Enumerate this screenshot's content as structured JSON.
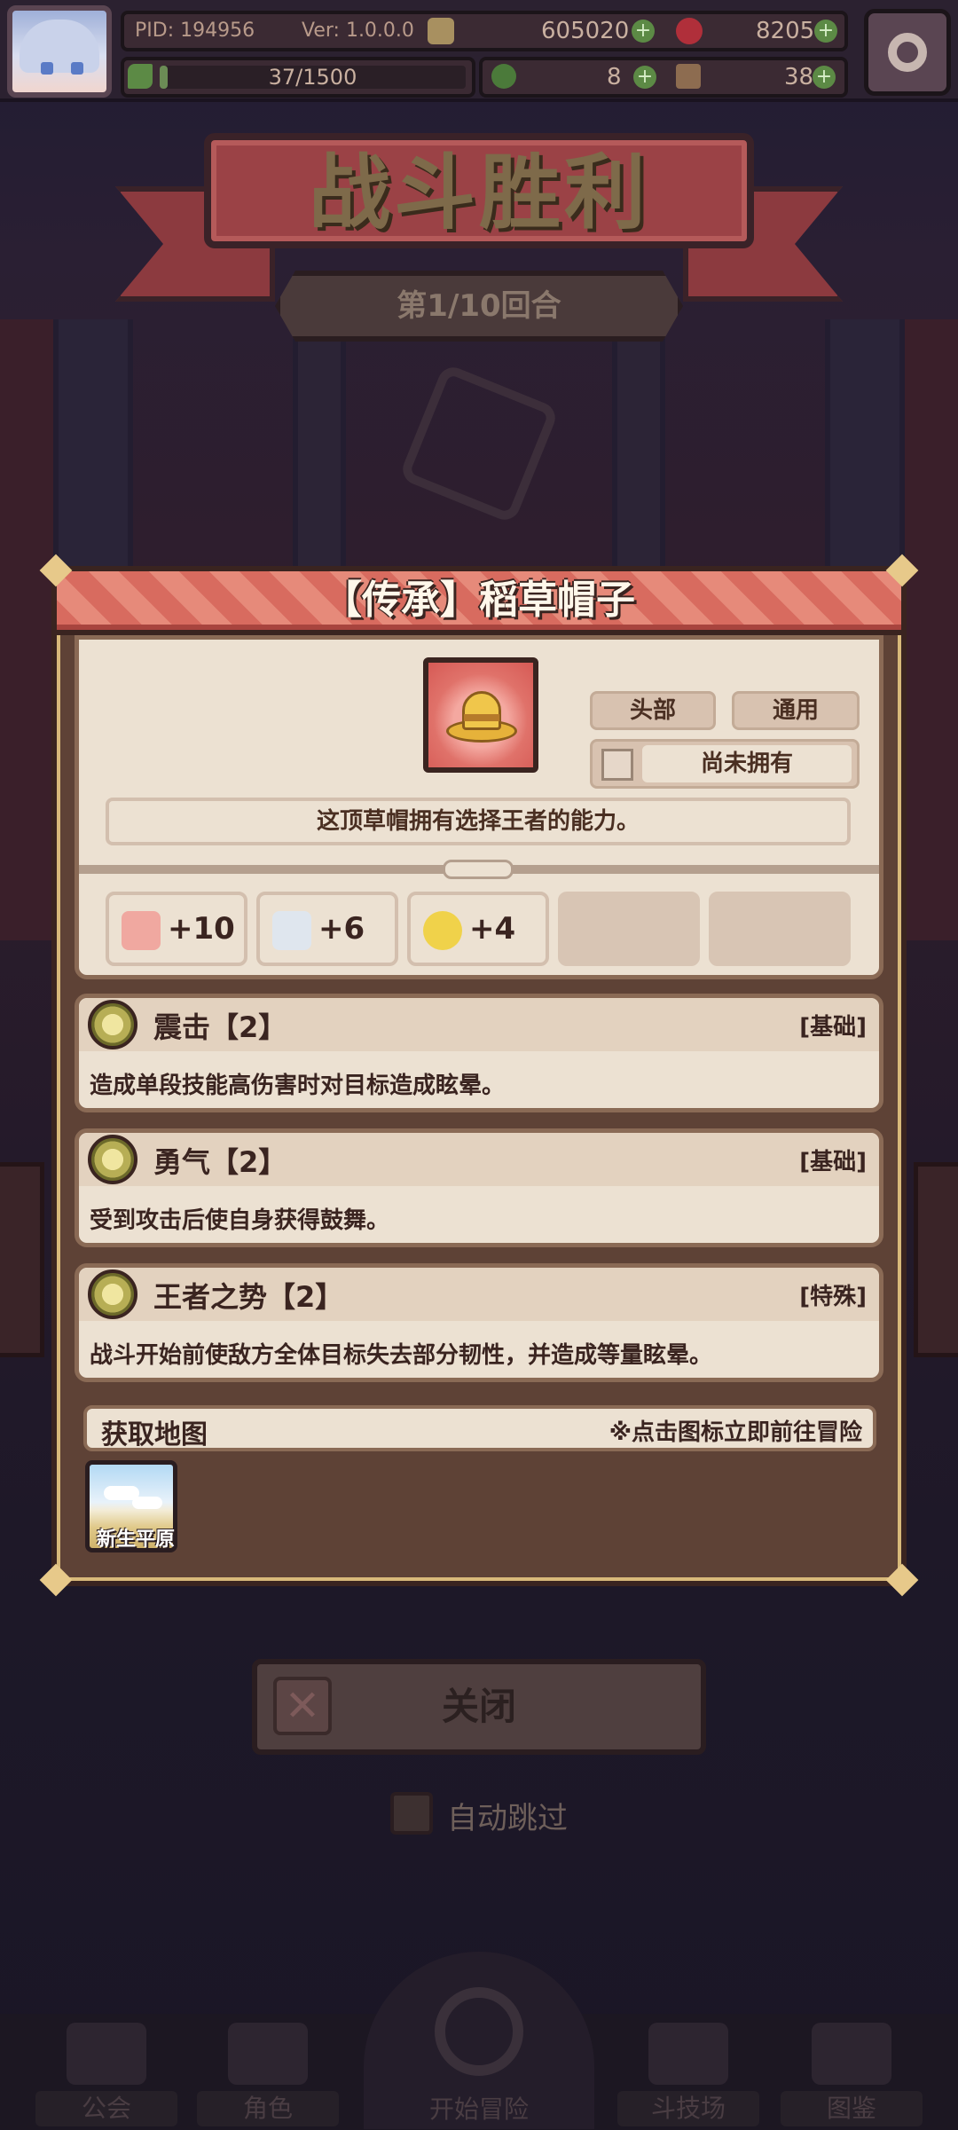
{
  "topbar": {
    "pid": "PID: 194956",
    "version": "Ver: 1.0.0.0",
    "gold": "605020",
    "gems": "8205",
    "exp": "37/1500",
    "exp_fraction": 0.025,
    "clover": "8",
    "stone": "38"
  },
  "battle": {
    "title": "战斗胜利",
    "round": "第1/10回合"
  },
  "item": {
    "title": "【传承】稻草帽子",
    "slot": "头部",
    "type": "通用",
    "ownership": "尚未拥有",
    "description": "这顶草帽拥有选择王者的能力。",
    "stats": [
      {
        "icon": "fist-icon",
        "value": "+10",
        "color": "#f0a8a0"
      },
      {
        "icon": "shield-icon",
        "value": "+6",
        "color": "#dfe6ee"
      },
      {
        "icon": "clock-icon",
        "value": "+4",
        "color": "#f0d24a"
      }
    ],
    "skills": [
      {
        "name": "震击【2】",
        "tag": "[基础]",
        "desc": "造成单段技能高伤害时对目标造成眩晕。"
      },
      {
        "name": "勇气【2】",
        "tag": "[基础]",
        "desc": "受到攻击后使自身获得鼓舞。"
      },
      {
        "name": "王者之势【2】",
        "tag": "[特殊]",
        "desc": "战斗开始前使敌方全体目标失去部分韧性，并造成等量眩晕。"
      }
    ],
    "map_section": {
      "title": "获取地图",
      "hint": "※点击图标立即前往冒险",
      "maps": [
        "新生平原"
      ]
    }
  },
  "dialog": {
    "close_label": "关闭",
    "auto_skip_label": "自动跳过"
  },
  "nav": {
    "guild": "公会",
    "character": "角色",
    "adventure": "开始冒险",
    "arena": "斗技场",
    "codex": "图鉴"
  },
  "colors": {
    "panel_bg": "#5e4236",
    "card_bg": "#ece1d2",
    "header_red": "#d86b5f",
    "text_dark": "#3a2420"
  }
}
